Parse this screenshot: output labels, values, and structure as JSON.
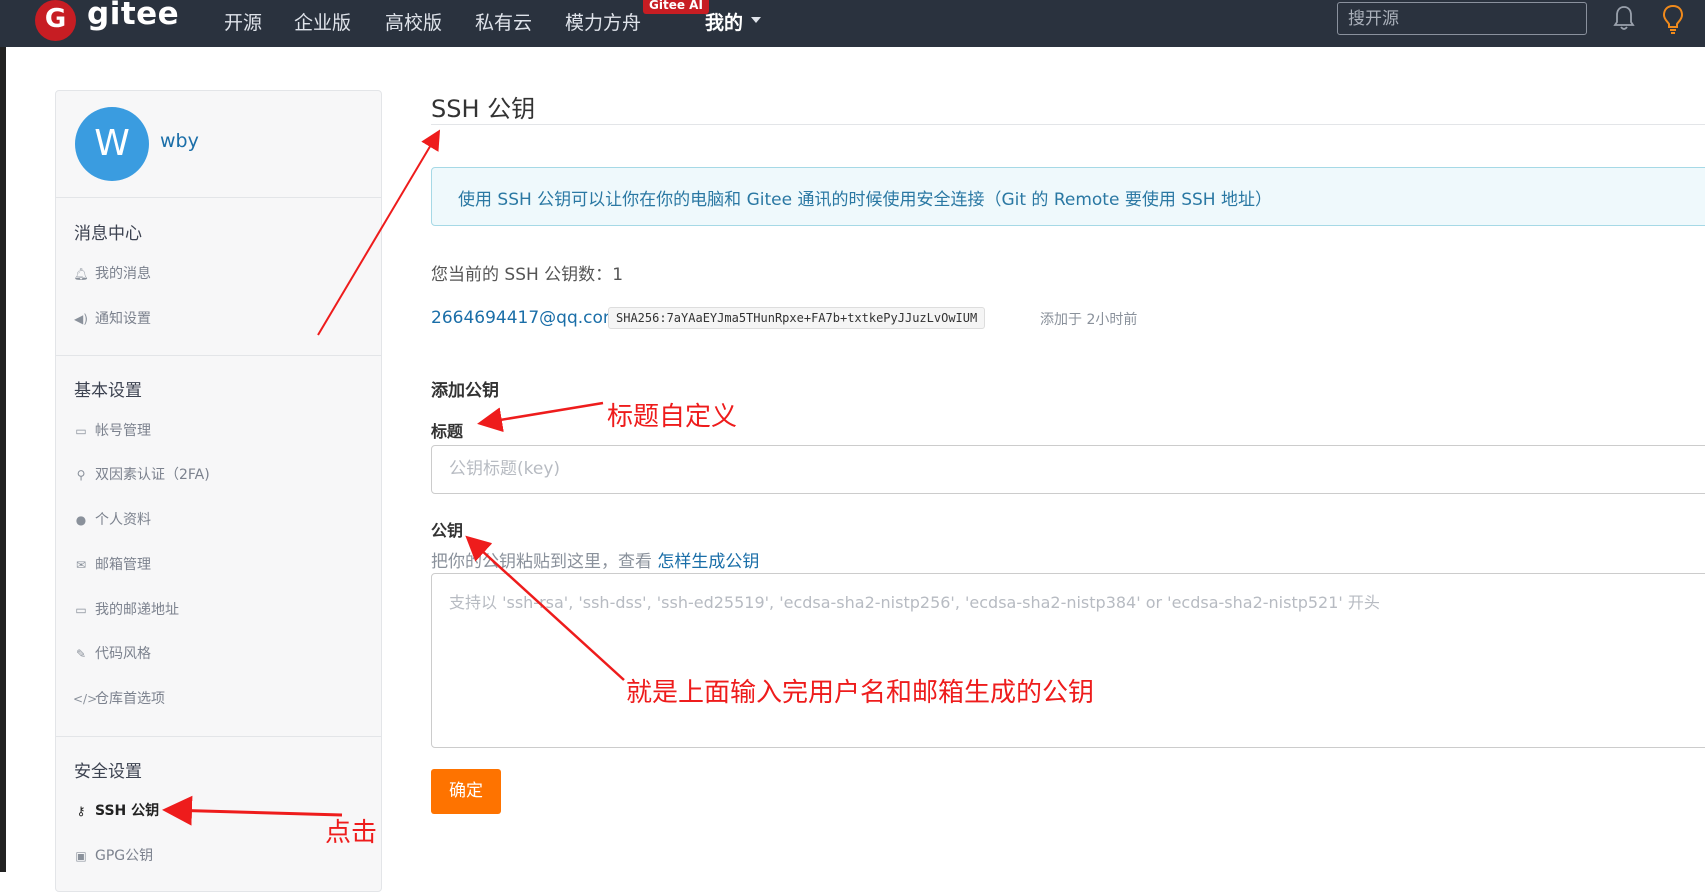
{
  "navbar": {
    "brand": "gitee",
    "logo_letter": "G",
    "items": [
      "开源",
      "企业版",
      "高校版",
      "私有云",
      "模力方舟"
    ],
    "ai_badge": "Gitee AI",
    "mine": "我的",
    "search_placeholder": "搜开源",
    "icons": [
      "bell-icon",
      "lightbulb-icon"
    ]
  },
  "sidebar": {
    "avatar_letter": "W",
    "username": "wby",
    "sections": [
      {
        "title": "消息中心",
        "items": [
          {
            "label": "我的消息",
            "icon": "bell-icon"
          },
          {
            "label": "通知设置",
            "icon": "volume-icon"
          }
        ]
      },
      {
        "title": "基本设置",
        "items": [
          {
            "label": "帐号管理",
            "icon": "id-card-icon"
          },
          {
            "label": "双因素认证（2FA)",
            "icon": "user-shield-icon"
          },
          {
            "label": "个人资料",
            "icon": "user-icon"
          },
          {
            "label": "邮箱管理",
            "icon": "envelope-icon"
          },
          {
            "label": "我的邮递地址",
            "icon": "address-card-icon"
          },
          {
            "label": "代码风格",
            "icon": "brush-icon"
          },
          {
            "label": "仓库首选项",
            "icon": "code-icon"
          }
        ]
      },
      {
        "title": "安全设置",
        "items": [
          {
            "label": "SSH 公钥",
            "icon": "key-icon",
            "active": true
          },
          {
            "label": "GPG公钥",
            "icon": "lock-icon"
          }
        ]
      }
    ]
  },
  "main": {
    "title": "SSH 公钥",
    "info": "使用 SSH 公钥可以让你在你的电脑和 Gitee 通讯的时候使用安全连接（Git 的 Remote 要使用 SSH 地址）",
    "key_count_label": "您当前的 SSH 公钥数：",
    "key_count": "1",
    "key": {
      "name": "2664694417@qq.com",
      "fingerprint": "SHA256:7aYAaEYJma5THunRpxe+FA7b+txtkePyJJuzLvOwIUM",
      "added": "添加于 2小时前"
    },
    "add_title": "添加公钥",
    "title_label": "标题",
    "title_placeholder": "公钥标题(key)",
    "key_label": "公钥",
    "key_help_prefix": "把你的公钥粘贴到这里，查看",
    "key_help_link": "怎样生成公钥",
    "key_placeholder": "支持以 'ssh-rsa', 'ssh-dss', 'ssh-ed25519', 'ecdsa-sha2-nistp256', 'ecdsa-sha2-nistp384' or 'ecdsa-sha2-nistp521' 开头",
    "submit": "确定"
  },
  "annotations": {
    "title_note": "标题自定义",
    "key_note": "就是上面输入完用户名和邮箱生成的公钥",
    "click_note": "点击",
    "arrow_color": "#ee1c1c"
  }
}
